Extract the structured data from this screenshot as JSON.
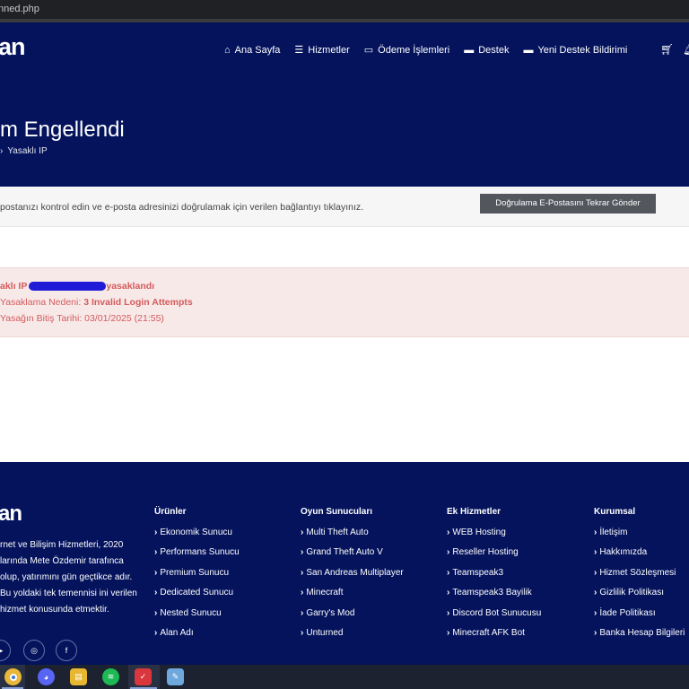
{
  "browser": {
    "url": "nned.php"
  },
  "nav": {
    "logo": "an",
    "items": [
      {
        "icon": "home-icon",
        "glyph": "⌂",
        "label": "Ana Sayfa"
      },
      {
        "icon": "list-icon",
        "glyph": "☰",
        "label": "Hizmetler"
      },
      {
        "icon": "credit-card-icon",
        "glyph": "▭",
        "label": "Ödeme İşlemleri"
      },
      {
        "icon": "ticket-icon",
        "glyph": "▬",
        "label": "Destek"
      },
      {
        "icon": "ticket-plus-icon",
        "glyph": "▬",
        "label": "Yeni Destek Bildirimi"
      }
    ]
  },
  "hero": {
    "title": "m Engellendi",
    "breadcrumb_sep": "›",
    "breadcrumb_current": "Yasaklı IP"
  },
  "verify": {
    "text": "postanızı kontrol edin ve e-posta adresinizi doğrulamak için verilen bağlantıyı tıklayınız.",
    "button": "Doğrulama E-Postasını Tekrar Gönder"
  },
  "alert": {
    "line1_prefix": "aklı IP",
    "line1_suffix": "yasaklandı",
    "line2_label": "Yasaklama Nedeni:",
    "line2_value": "3 Invalid Login Attempts",
    "line3_label": "Yasağın Bitiş Tarihi:",
    "line3_value": "03/01/2025 (21:55)"
  },
  "footer": {
    "logo": "an",
    "description": "rnet ve Bilişim Hizmetleri, 2020 larında Mete Özdemir tarafınca olup, yatırımını gün geçtikce adır. Bu yoldaki tek temennisi ini verilen hizmet konusunda etmektir.",
    "columns": [
      {
        "title": "Ürünler",
        "links": [
          "Ekonomik Sunucu",
          "Performans Sunucu",
          "Premium Sunucu",
          "Dedicated Sunucu",
          "Nested Sunucu",
          "Alan Adı"
        ]
      },
      {
        "title": "Oyun Sunucuları",
        "links": [
          "Multi Theft Auto",
          "Grand Theft Auto V",
          "San Andreas Multiplayer",
          "Minecraft",
          "Garry's Mod",
          "Unturned"
        ]
      },
      {
        "title": "Ek Hizmetler",
        "links": [
          "WEB Hosting",
          "Reseller Hosting",
          "Teamspeak3",
          "Teamspeak3 Bayilik",
          "Discord Bot Sunucusu",
          "Minecraft AFK Bot"
        ]
      },
      {
        "title": "Kurumsal",
        "links": [
          "İletişim",
          "Hakkımızda",
          "Hizmet Sözleşmesi",
          "Gizlilik Politikası",
          "İade Politikası",
          "Banka Hesap Bilgileri"
        ]
      }
    ]
  },
  "colors": {
    "navy": "#04135c",
    "alert_text": "#d35b5b",
    "alert_bg": "#f8e9e9",
    "button": "#53565d"
  }
}
